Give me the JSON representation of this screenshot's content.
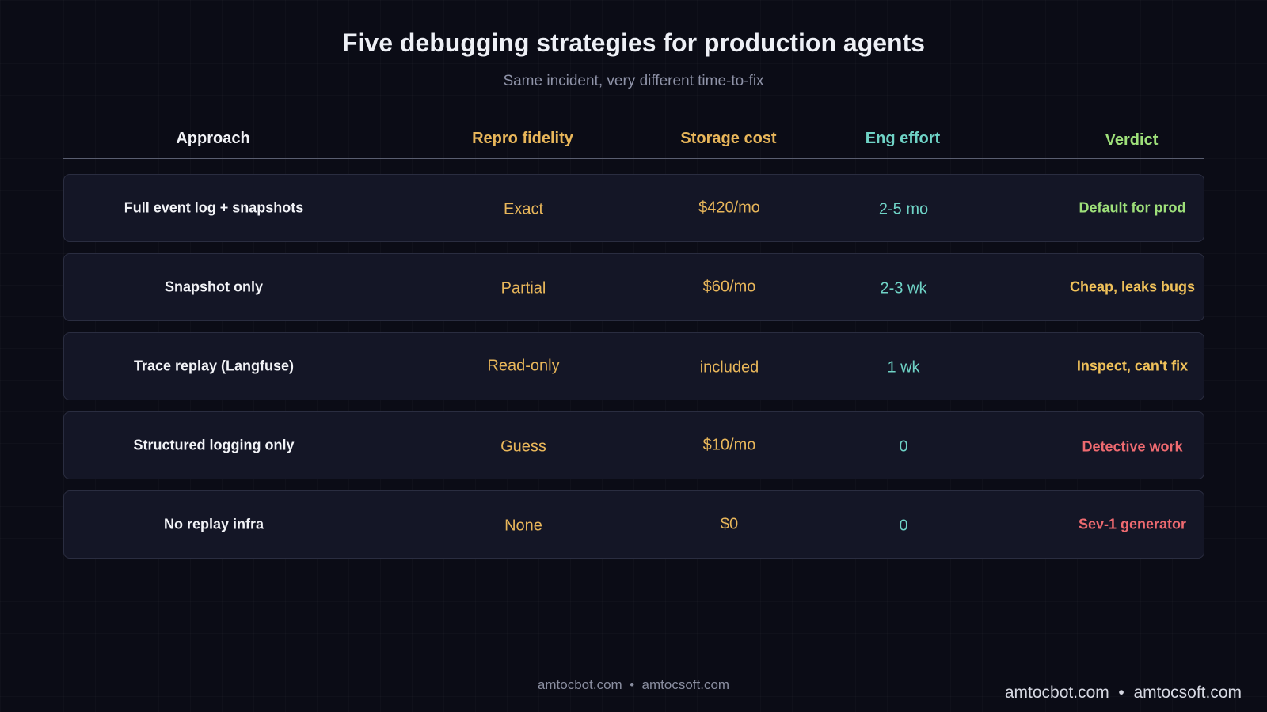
{
  "header": {
    "title": "Five debugging strategies for production agents",
    "subtitle": "Same incident, very different time-to-fix"
  },
  "colors": {
    "approach_header": "#f2f3f7",
    "fidelity": "#e8b65a",
    "cost": "#e8b65a",
    "effort": "#6fd3c6",
    "verdict_good": "#9ee07a",
    "verdict_warn": "#f0c15a",
    "verdict_bad": "#ee6a70"
  },
  "table": {
    "columns": [
      "Approach",
      "Repro fidelity",
      "Storage cost",
      "Eng effort",
      "Verdict"
    ],
    "rows": [
      {
        "approach": "Full event log + snapshots",
        "fidelity": "Exact",
        "cost": "$420/mo",
        "effort": "2-5 mo",
        "verdict": "Default for prod",
        "verdict_color": "#9ee07a"
      },
      {
        "approach": "Snapshot only",
        "fidelity": "Partial",
        "cost": "$60/mo",
        "effort": "2-3 wk",
        "verdict": "Cheap, leaks bugs",
        "verdict_color": "#f0c15a"
      },
      {
        "approach": "Trace replay (Langfuse)",
        "fidelity": "Read-only",
        "cost": "included",
        "effort": "1 wk",
        "verdict": "Inspect, can't fix",
        "verdict_color": "#f0c15a"
      },
      {
        "approach": "Structured logging only",
        "fidelity": "Guess",
        "cost": "$10/mo",
        "effort": "0",
        "verdict": "Detective work",
        "verdict_color": "#ee6a70"
      },
      {
        "approach": "No replay infra",
        "fidelity": "None",
        "cost": "$0",
        "effort": "0",
        "verdict": "Sev-1 generator",
        "verdict_color": "#ee6a70"
      }
    ]
  },
  "footer": {
    "center": "amtocbot.com  •  amtocsoft.com",
    "right": "amtocbot.com  •  amtocsoft.com"
  }
}
